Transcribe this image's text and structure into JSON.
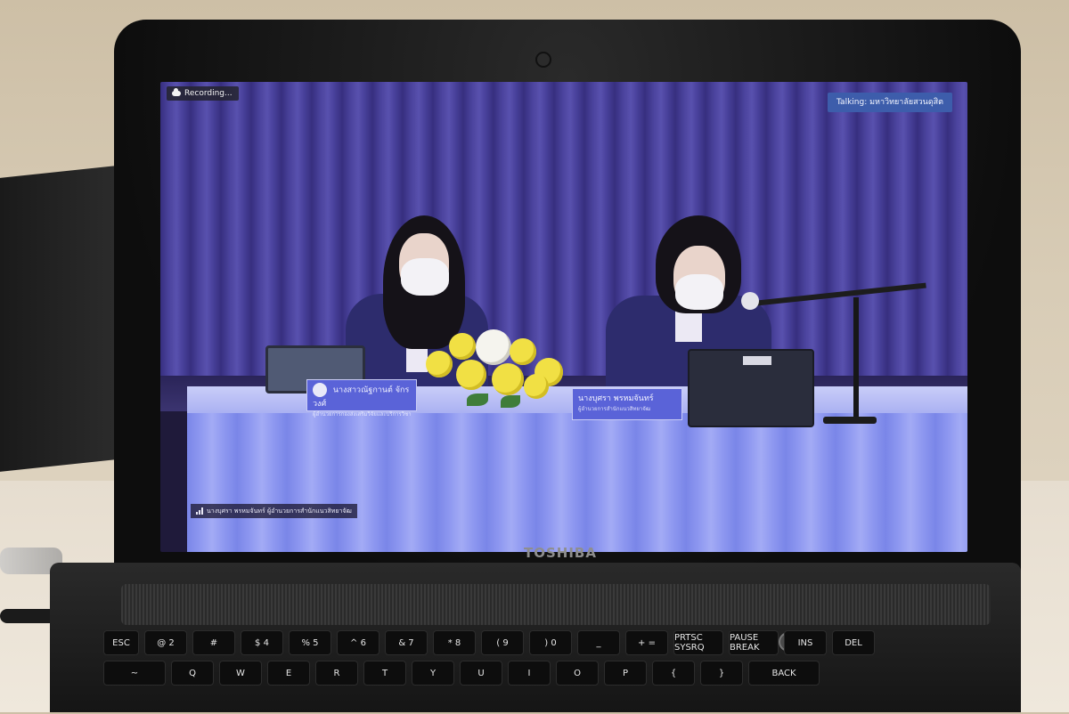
{
  "zoom": {
    "recording_label": "Recording...",
    "talking_label": "Talking: มหาวิทยาลัยสวนดุสิต",
    "participant_name": "นางบุศรา พรหมจันทร์ ผู้อำนวยการสำนักแนวสิทยาจัฒ"
  },
  "stage": {
    "left_nameplate": "นางสาวณัฐกานต์ จักรวงศ์",
    "left_nameplate_sub": "ผู้อำนวยการกองส่งเสริมวิจัยและบริการวิชาการ",
    "right_nameplate": "นางบุศรา พรหมจันทร์",
    "right_nameplate_sub": "ผู้อำนวยการสำนักแนวสิทยาจัฒ"
  },
  "laptop": {
    "brand": "TOSHIBA",
    "colors": {
      "body": "#0d0d0d",
      "screen_curtain": "#4f47a6",
      "zoom_talking_bg": "#3d5dab"
    }
  },
  "keyboard": {
    "row1": [
      "ESC",
      "@ 2",
      "#",
      "$ 4",
      "% 5",
      "^ 6",
      "& 7",
      "* 8",
      "( 9",
      ") 0",
      "_",
      "+ =",
      "PRTSC SYSRQ",
      "PAUSE BREAK",
      "INS",
      "DEL"
    ],
    "row2": [
      "~",
      "Q",
      "W",
      "E",
      "R",
      "T",
      "Y",
      "U",
      "I",
      "O",
      "P",
      "{",
      "}",
      "BACK"
    ]
  }
}
